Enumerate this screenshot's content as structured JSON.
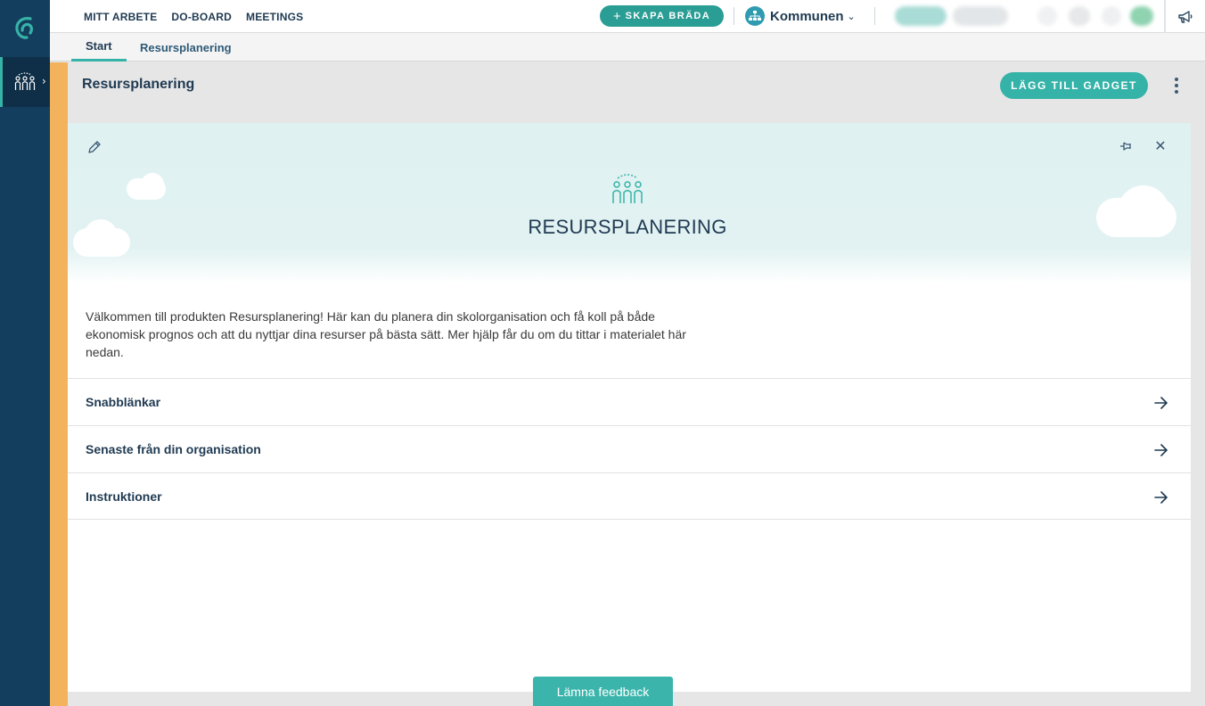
{
  "topnav": [
    "MITT ARBETE",
    "DO-BOARD",
    "MEETINGS"
  ],
  "create_button": {
    "plus": "+",
    "label": "SKAPA BRÄDA"
  },
  "org": {
    "label": "Kommunen"
  },
  "tabs": [
    {
      "label": "Start",
      "active": true
    },
    {
      "label": "Resursplanering",
      "active": false
    }
  ],
  "page": {
    "title": "Resursplanering",
    "add_gadget_label": "LÄGG TILL GADGET"
  },
  "gadget": {
    "title": "RESURSPLANERING",
    "intro": "Välkommen till produkten Resursplanering! Här kan du planera din skolorganisation och få koll på både ekonomisk prognos och att du nyttjar dina resurser på bästa sätt. Mer hjälp får du om du tittar i materialet här nedan.",
    "close_glyph": "✕",
    "rows": [
      {
        "label": "Snabblänkar"
      },
      {
        "label": "Senaste från din organisation"
      },
      {
        "label": "Instruktioner"
      }
    ]
  },
  "feedback_label": "Lämna feedback",
  "colors": {
    "rail": "#133e5e",
    "accent": "#36b3a8",
    "stripe": "#f3b35d",
    "hero_bg": "#e0f1f1"
  },
  "icons": [
    "app-logo-icon",
    "people-group-icon",
    "chevron-right-icon",
    "org-chart-icon",
    "chevron-down-icon",
    "megaphone-icon",
    "pencil-icon",
    "pin-icon",
    "close-icon",
    "arrow-right-icon",
    "kebab-menu-icon"
  ]
}
